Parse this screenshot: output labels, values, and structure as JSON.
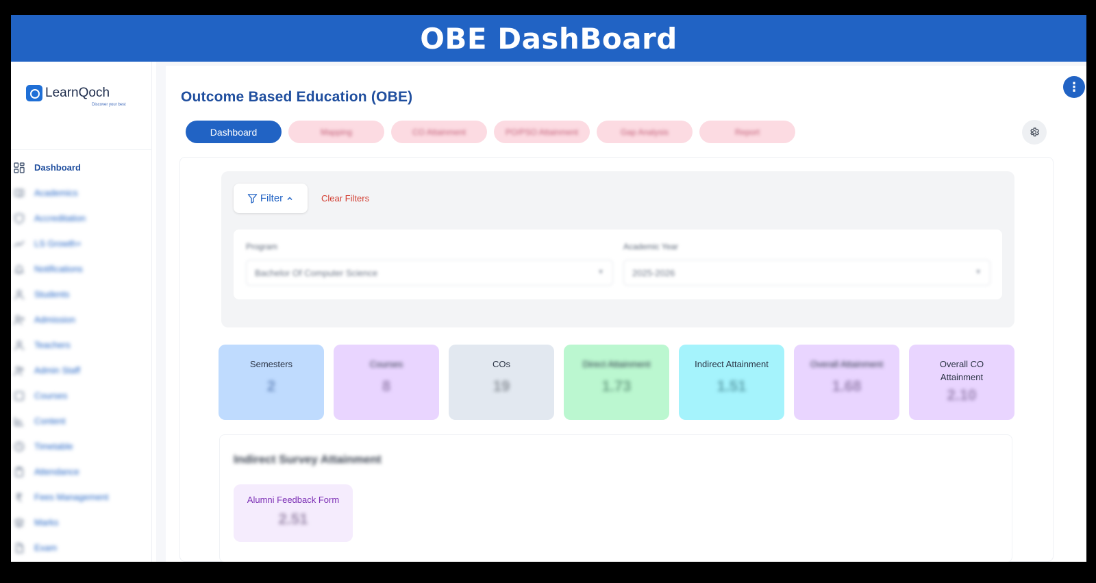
{
  "banner": {
    "title": "OBE DashBoard"
  },
  "brand": {
    "name": "LearnQoch",
    "tagline": "Discover your best"
  },
  "sidebar": {
    "items": [
      {
        "label": "Dashboard",
        "icon": "grid-icon",
        "active": true
      },
      {
        "label": "Academics",
        "icon": "book-icon"
      },
      {
        "label": "Accreditation",
        "icon": "shield-icon"
      },
      {
        "label": "LS Growth+",
        "icon": "trend-icon"
      },
      {
        "label": "Notifications",
        "icon": "bell-icon"
      },
      {
        "label": "Students",
        "icon": "user-icon"
      },
      {
        "label": "Admission",
        "icon": "user-plus-icon"
      },
      {
        "label": "Teachers",
        "icon": "user-icon"
      },
      {
        "label": "Admin Staff",
        "icon": "users-icon"
      },
      {
        "label": "Courses",
        "icon": "book-icon"
      },
      {
        "label": "Content",
        "icon": "bar-chart-icon"
      },
      {
        "label": "Timetable",
        "icon": "clock-icon"
      },
      {
        "label": "Attendance",
        "icon": "clipboard-icon"
      },
      {
        "label": "Fees Management",
        "icon": "rupee-icon"
      },
      {
        "label": "Marks",
        "icon": "layers-icon"
      },
      {
        "label": "Exam",
        "icon": "file-icon"
      }
    ]
  },
  "page": {
    "title": "Outcome Based Education (OBE)"
  },
  "tabs": [
    {
      "label": "Dashboard",
      "active": true
    },
    {
      "label": "Mapping"
    },
    {
      "label": "CO Attainment"
    },
    {
      "label": "PO/PSO Attainment"
    },
    {
      "label": "Gap Analysis"
    },
    {
      "label": "Report"
    }
  ],
  "filter": {
    "button_label": "Filter",
    "clear_label": "Clear Filters",
    "program_label": "Program",
    "program_value": "Bachelor Of Computer Science",
    "year_label": "Academic Year",
    "year_value": "2025-2026"
  },
  "stats": [
    {
      "label": "Semesters",
      "value": "2",
      "bg": "#bfdbfe",
      "color": "#6e8fc3",
      "label_blur": false
    },
    {
      "label": "Courses",
      "value": "8",
      "bg": "#e9d5ff",
      "color": "#9b86b3",
      "label_blur": true
    },
    {
      "label": "COs",
      "value": "19",
      "bg": "#e2e8f0",
      "color": "#8e949c",
      "label_blur": false
    },
    {
      "label": "Direct Attainment",
      "value": "1.73",
      "bg": "#bbf7d0",
      "color": "#6fa488",
      "label_blur": true
    },
    {
      "label": "Indirect Attainment",
      "value": "1.51",
      "bg": "#a5f3fc",
      "color": "#5ea2ad",
      "label_blur": false
    },
    {
      "label": "Overall Attainment",
      "value": "1.68",
      "bg": "#e9d5ff",
      "color": "#9b86b3",
      "label_blur": true
    },
    {
      "label": "Overall CO Attainment",
      "value": "2.10",
      "bg": "#e9d5ff",
      "color": "#9b86b3",
      "label_blur": false,
      "two_line": true
    }
  ],
  "survey": {
    "title": "Indirect Survey Attainment",
    "items": [
      {
        "label": "Alumni Feedback Form",
        "value": "2.51"
      }
    ]
  },
  "colors": {
    "primary": "#2163c4",
    "danger": "#d23b2f",
    "tab_inactive": "#fcdbe2"
  }
}
